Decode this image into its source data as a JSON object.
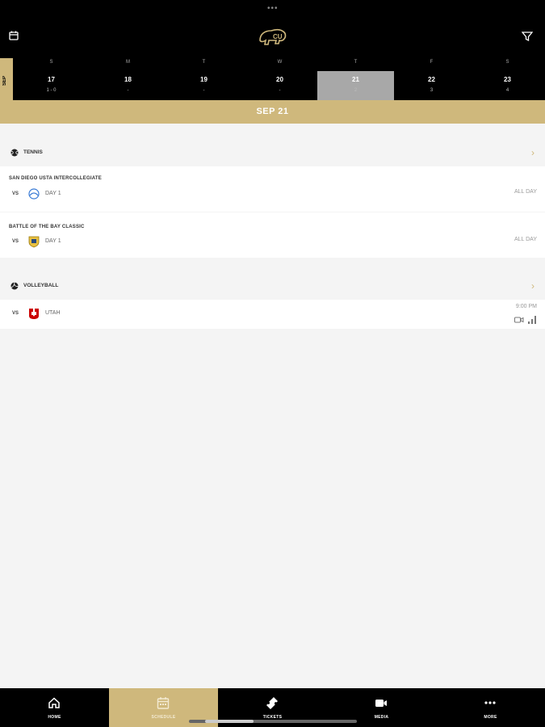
{
  "header": {
    "overflow_dots": "•••",
    "left_icon": "calendar-icon",
    "logo": "buffalo-logo",
    "right_icon": "filter-icon"
  },
  "week": {
    "month": "SEP",
    "days": [
      {
        "dow": "S",
        "num": "17",
        "sub": "1 - 0"
      },
      {
        "dow": "M",
        "num": "18",
        "sub": "-"
      },
      {
        "dow": "T",
        "num": "19",
        "sub": "-"
      },
      {
        "dow": "W",
        "num": "20",
        "sub": "-"
      },
      {
        "dow": "T",
        "num": "21",
        "sub": "2",
        "selected": true
      },
      {
        "dow": "F",
        "num": "22",
        "sub": "3"
      },
      {
        "dow": "S",
        "num": "23",
        "sub": "4"
      }
    ]
  },
  "selected_date": "SEP 21",
  "sections": [
    {
      "sport": "TENNIS",
      "events": [
        {
          "title": "SAN DIEGO USTA INTERCOLLEGIATE",
          "vs": "VS",
          "opponent": "DAY 1",
          "time": "ALL DAY"
        },
        {
          "title": "BATTLE OF THE BAY CLASSIC",
          "vs": "VS",
          "opponent": "DAY 1",
          "time": "ALL DAY"
        }
      ]
    },
    {
      "sport": "VOLLEYBALL",
      "events": [
        {
          "title": "",
          "vs": "VS",
          "opponent": "UTAH",
          "time": "9:00 PM"
        }
      ]
    }
  ],
  "tabs": [
    {
      "label": "HOME",
      "icon": "home-icon"
    },
    {
      "label": "SCHEDULE",
      "icon": "calendar-icon",
      "active": true
    },
    {
      "label": "TICKETS",
      "icon": "ticket-icon"
    },
    {
      "label": "MEDIA",
      "icon": "video-icon"
    },
    {
      "label": "MORE",
      "icon": "more-icon"
    }
  ],
  "colors": {
    "gold": "#cfb87c",
    "black": "#000000",
    "utah_red": "#cc0000"
  }
}
